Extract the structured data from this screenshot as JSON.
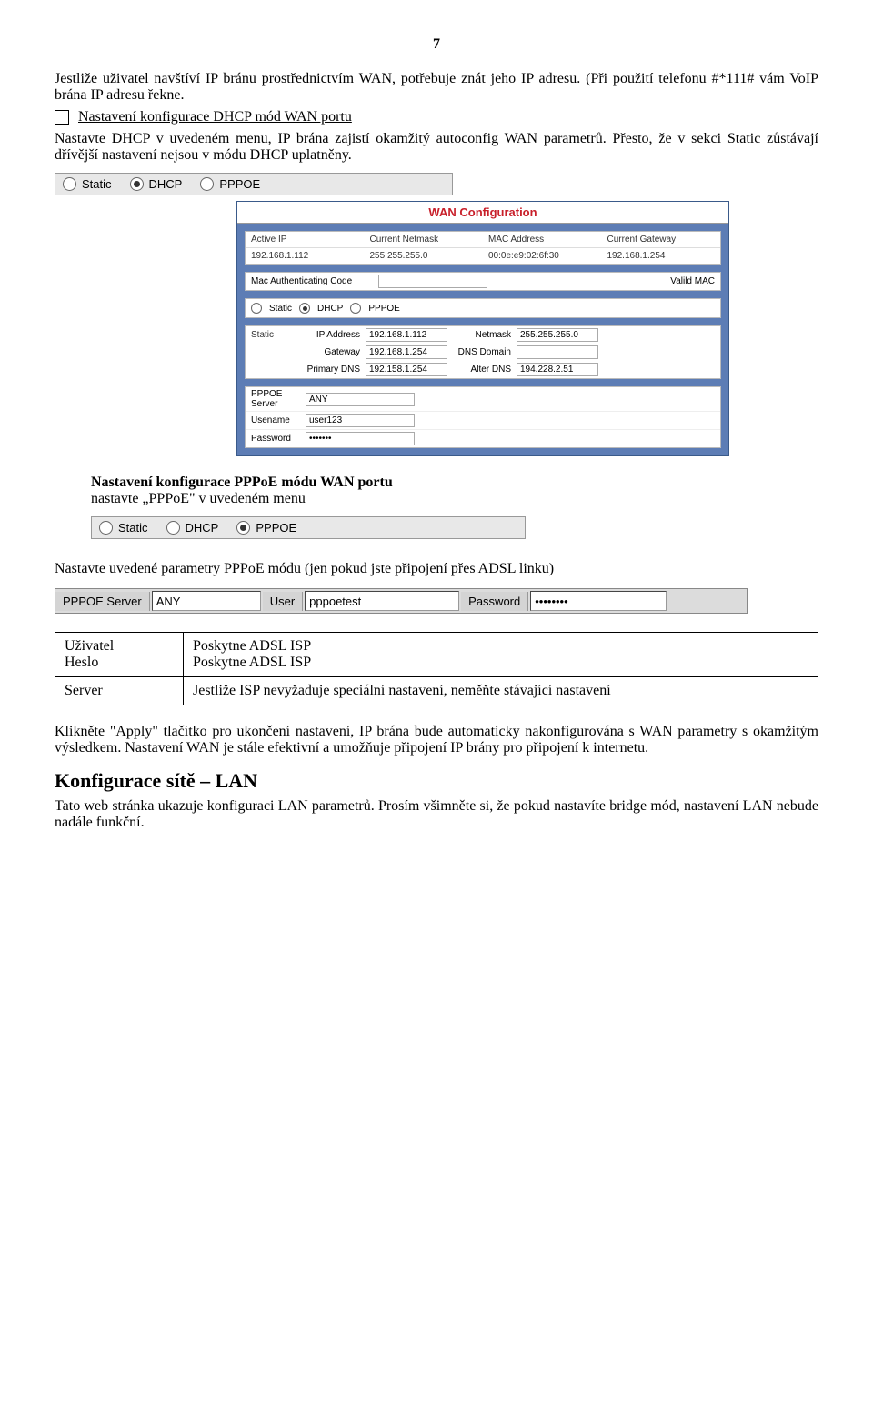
{
  "page_number": "7",
  "intro": {
    "p1": "Jestliže uživatel navštíví IP bránu prostřednictvím WAN, potřebuje znát  jeho IP adresu. (Při použití telefonu #*111# vám VoIP  brána IP adresu řekne.",
    "box": "",
    "heading_underline": "Nastavení konfigurace DHCP mód WAN portu",
    "p2": "Nastavte DHCP   v uvedeném menu, IP brána zajistí okamžitý autoconfig WAN parametrů.   Přesto, že v sekci Static zůstávají dřívější nastavení nejsou v módu DHCP uplatněny."
  },
  "radio_small": {
    "static": "Static",
    "dhcp": "DHCP",
    "pppoe": "PPPOE"
  },
  "wan": {
    "title": "WAN Configuration",
    "headers": {
      "active_ip": "Active IP",
      "netmask": "Current Netmask",
      "mac": "MAC Address",
      "gateway": "Current Gateway"
    },
    "values": {
      "active_ip": "192.168.1.112",
      "netmask": "255.255.255.0",
      "mac": "00:0e:e9:02:6f:30",
      "gateway": "192.168.1.254"
    },
    "mac_auth_label": "Mac Authenticating Code",
    "valid_mac": "Valild MAC",
    "mode": {
      "static": "Static",
      "dhcp": "DHCP",
      "pppoe": "PPPOE"
    },
    "static": {
      "group": "Static",
      "ip_label": "IP Address",
      "ip": "192.168.1.112",
      "netmask_label": "Netmask",
      "netmask": "255.255.255.0",
      "gateway_label": "Gateway",
      "gateway": "192.168.1.254",
      "dnsdomain_label": "DNS Domain",
      "dnsdomain": "",
      "primarydns_label": "Primary DNS",
      "primarydns": "192.158.1.254",
      "alterdns_label": "Alter DNS",
      "alterdns": "194.228.2.51"
    },
    "pppoe": {
      "server_label": "PPPOE Server",
      "server": "ANY",
      "user_label": "Usename",
      "user": "user123",
      "pass_label": "Password",
      "pass": "•••••••"
    }
  },
  "pppoe_section": {
    "heading_bold": "Nastavení konfigurace PPPoE módu WAN portu",
    "line2": "nastavte „PPPoE\" v uvedeném menu"
  },
  "radio_wide": {
    "static": "Static",
    "dhcp": "DHCP",
    "pppoe": "PPPOE"
  },
  "pppoe_params_title": "Nastavte uvedené parametry PPPoE módu (jen pokud jste připojení přes ADSL linku)",
  "pppoe_bar": {
    "server_label": "PPPOE Server",
    "server_value": "ANY",
    "user_label": "User",
    "user_value": "pppoetest",
    "pass_label": "Password",
    "pass_value": "••••••••"
  },
  "user_table": {
    "r1c1": "Uživatel",
    "r1c2": "Poskytne ADSL ISP",
    "r2c1": "Heslo",
    "r2c2": "Poskytne ADSL ISP",
    "r3c1": "Server",
    "r3c2": "Jestliže ISP nevyžaduje speciální nastavení, neměňte stávající nastavení"
  },
  "closing": {
    "p1": "Klikněte \"Apply\" tlačítko pro ukončení nastavení, IP brána bude automaticky nakonfigurována s WAN parametry s okamžitým výsledkem. Nastavení WAN je stále efektivní a umožňuje připojení IP brány pro připojení k internetu.",
    "h2": "Konfigurace sítě – LAN",
    "p2": "Tato web stránka ukazuje konfiguraci LAN parametrů. Prosím všimněte si, že pokud nastavíte bridge mód, nastavení LAN nebude nadále funkční."
  }
}
